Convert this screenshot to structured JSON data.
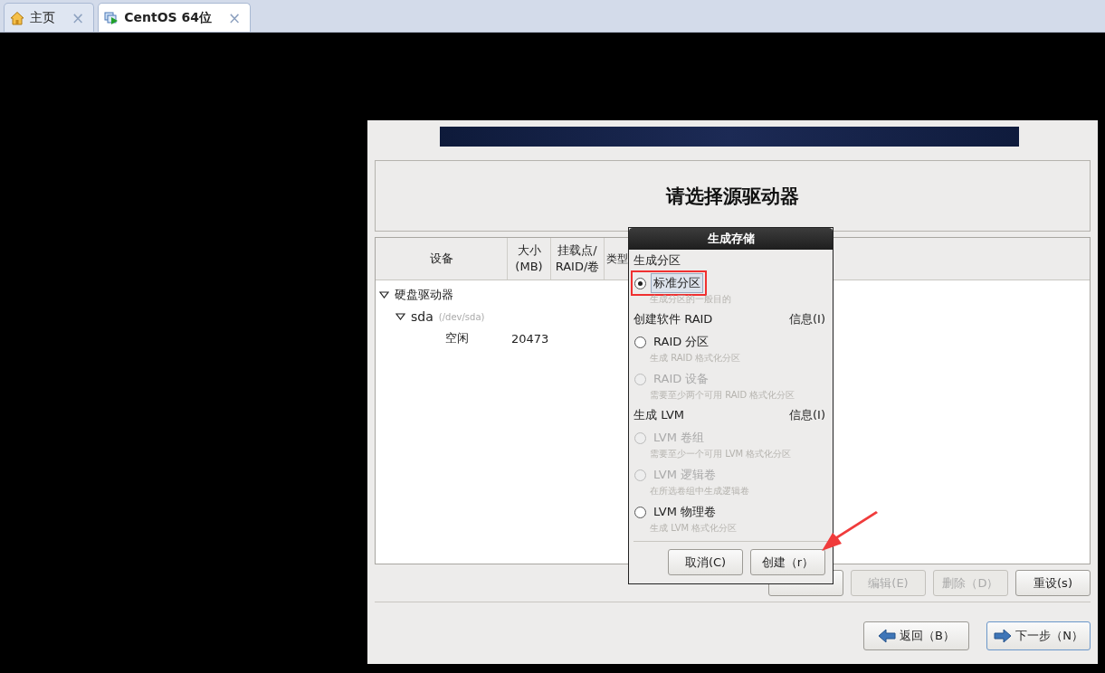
{
  "tabs": [
    {
      "label": "主页",
      "kind": "home",
      "selected": false,
      "close": "×"
    },
    {
      "label": "CentOS 64位",
      "kind": "machine",
      "selected": true,
      "close": "×"
    }
  ],
  "installer": {
    "title": "请选择源驱动器",
    "columns": [
      "设备",
      "大小\n(MB)",
      "挂载点/\nRAID/卷",
      "类型"
    ],
    "tree": [
      {
        "device": "硬盘驱动器",
        "expanded": true,
        "children": [
          {
            "device": "sda",
            "detail": "(/dev/sda)",
            "expanded": true,
            "children": [
              {
                "device": "空闲",
                "size": "20473"
              }
            ]
          }
        ]
      }
    ],
    "actions": [
      {
        "disabled": false
      },
      {
        "label": "编辑(E)",
        "disabled": true
      },
      {
        "label": "删除（D）",
        "disabled": true
      },
      {
        "label": "重设(s)",
        "disabled": false
      }
    ],
    "nav": [
      {
        "label": "返回（B）",
        "kind": "back",
        "focused": false
      },
      {
        "label": "下一步（N）",
        "kind": "next",
        "focused": true
      }
    ]
  },
  "dialog": {
    "title": "生成存储",
    "sections": [
      {
        "heading": "生成分区",
        "options": [
          {
            "label": "标准分区",
            "description": "生成分区的一般目的",
            "selected": true,
            "disabled": false,
            "highlighted": true
          }
        ]
      },
      {
        "heading": "创建软件 RAID",
        "info": "信息(I)",
        "options": [
          {
            "label": "RAID 分区",
            "description": "生成 RAID 格式化分区",
            "selected": false,
            "disabled": false,
            "highlighted": false
          },
          {
            "label": "RAID 设备",
            "description": "需要至少两个可用 RAID 格式化分区",
            "selected": false,
            "disabled": true,
            "highlighted": false
          }
        ]
      },
      {
        "heading": "生成 LVM",
        "info": "信息(I)",
        "options": [
          {
            "label": "LVM 卷组",
            "description": "需要至少一个可用 LVM 格式化分区",
            "selected": false,
            "disabled": true,
            "highlighted": false
          },
          {
            "label": "LVM 逻辑卷",
            "description": "在所选卷组中生成逻辑卷",
            "selected": false,
            "disabled": true,
            "highlighted": false
          },
          {
            "label": "LVM 物理卷",
            "description": "生成 LVM 格式化分区",
            "selected": false,
            "disabled": false,
            "highlighted": false
          }
        ]
      }
    ],
    "buttons": [
      "取消(C)",
      "创建（r）"
    ]
  },
  "annotations": [
    {
      "kind": "arrow"
    }
  ]
}
